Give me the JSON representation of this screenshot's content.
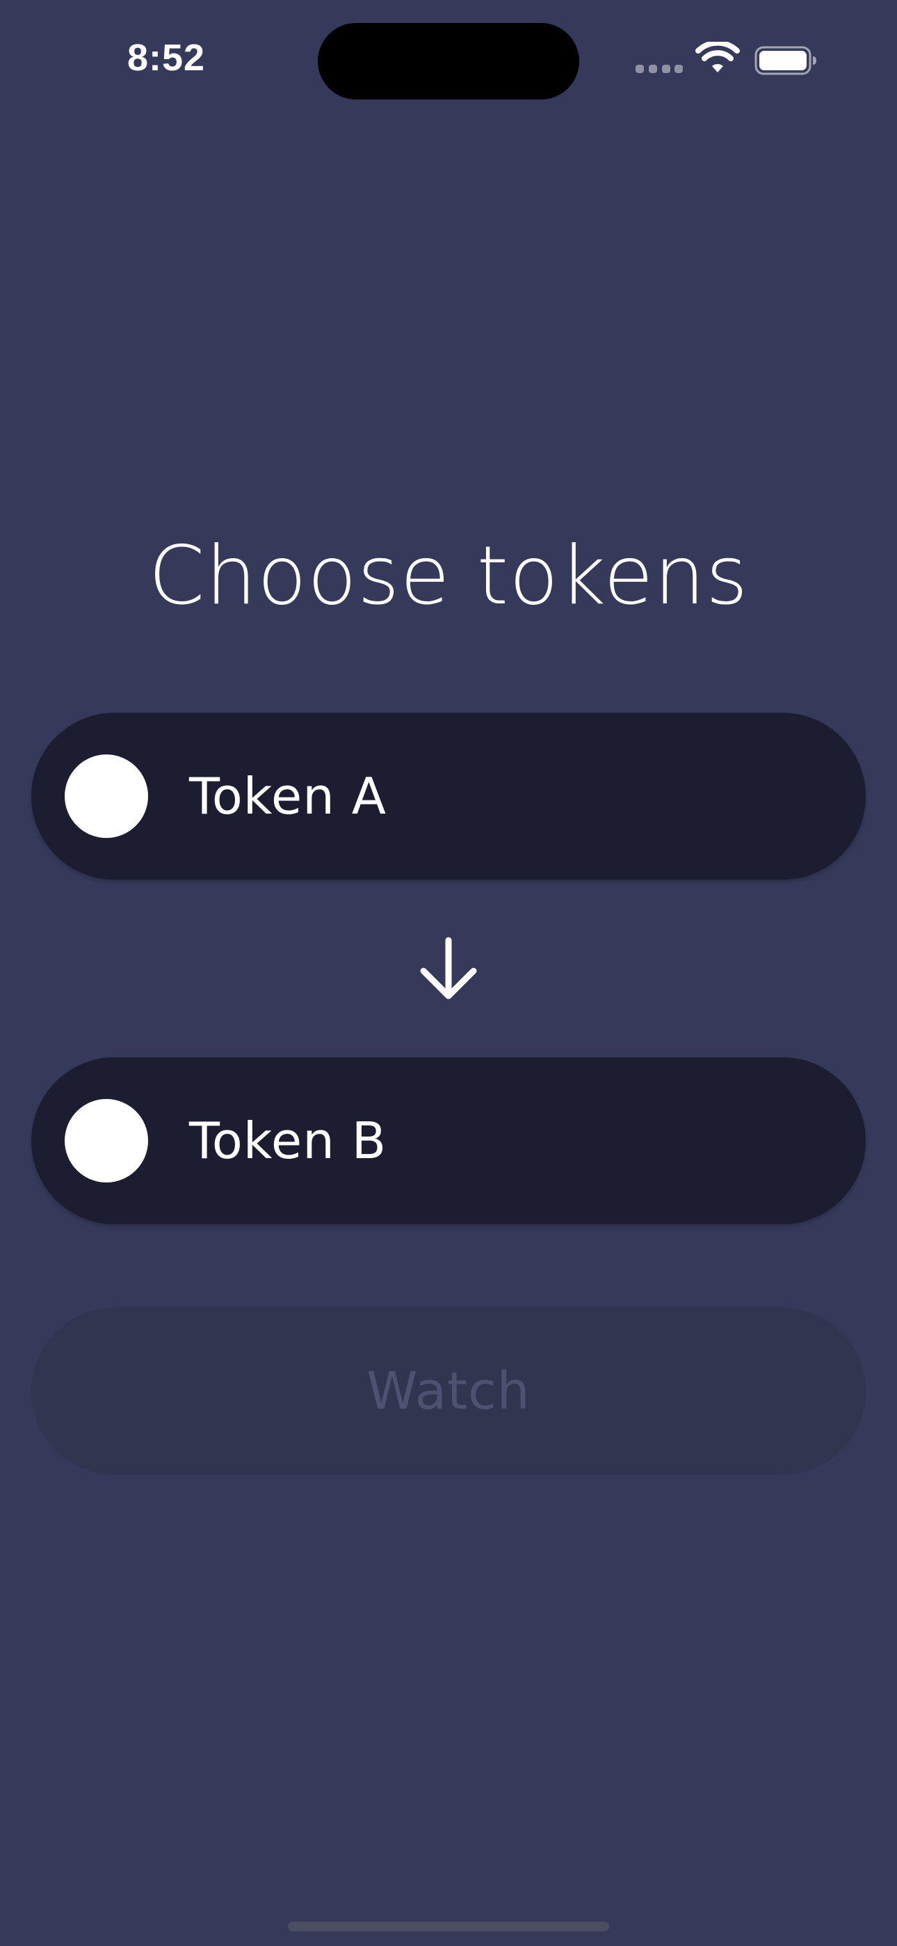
{
  "status_bar": {
    "time": "8:52",
    "icons": [
      "cellular-signal-icon",
      "wifi-icon",
      "battery-icon"
    ]
  },
  "screen": {
    "title": "Choose tokens",
    "token_a": {
      "label": "Token A",
      "icon": "token-placeholder-icon"
    },
    "swap_icon": "arrow-down-icon",
    "token_b": {
      "label": "Token B",
      "icon": "token-placeholder-icon"
    },
    "watch_button": {
      "label": "Watch",
      "enabled": false
    }
  },
  "colors": {
    "background": "#353a5a",
    "pill": "#1c1d31",
    "disabled_button": "#31354f",
    "disabled_text": "#4d5272",
    "text": "#ffffff"
  }
}
